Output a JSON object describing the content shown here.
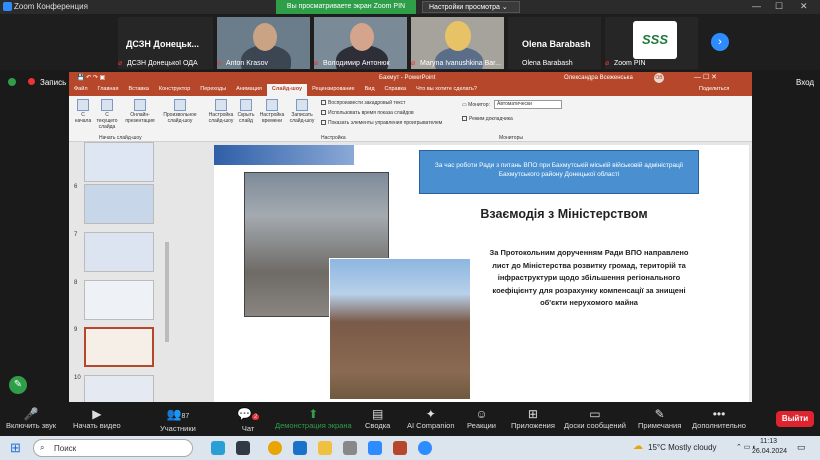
{
  "window": {
    "title": "Zoom Конференция"
  },
  "share": {
    "banner": "Вы просматриваете экран Zoom PIN",
    "settings": "Настройки просмотра"
  },
  "participants": [
    {
      "big_name": "ДСЗН Донецьк...",
      "name": "ДСЗН Донецької ОДА"
    },
    {
      "name": "Anton Krasov"
    },
    {
      "name": "Володимир Антонюк"
    },
    {
      "name": "Maryna Ivanushkina Bar..."
    },
    {
      "big_name": "Olena Barabash",
      "name": "Olena Barabash"
    },
    {
      "name": "Zoom PIN",
      "logo": "SSS"
    }
  ],
  "recording": {
    "label": "Запись",
    "exit_fullscreen": "Вход"
  },
  "ppt": {
    "title_left": "Бахмут - PowerPoint",
    "user": "Олександра Всеженська",
    "user_initials": "ОВ",
    "menu": [
      "Файл",
      "Главная",
      "Вставка",
      "Конструктор",
      "Переходы",
      "Анимация",
      "Слайд-шоу",
      "Рецензирование",
      "Вид",
      "Справка",
      "Что вы хотите сделать?"
    ],
    "active_menu": "Слайд-шоу",
    "share_label": "Поделиться",
    "ribbon": {
      "buttons": [
        "С начала",
        "С текущего слайда",
        "Онлайн-презентация",
        "Произвольное слайд-шоу",
        "Настройка слайд-шоу",
        "Скрыть слайд",
        "Настройка времени",
        "Записать слайд-шоу"
      ],
      "group_start": "Начать слайд-шоу",
      "group_setup": "Настройка",
      "group_monitors": "Мониторы",
      "checks": [
        "Воспроизвести закадровый текст",
        "Использовать время показа слайдов",
        "Показать элементы управления проигрывателем"
      ],
      "monitor_label": "Монитор:",
      "monitor_value": "Автоматически",
      "presenter_view": "Режим докладчика"
    },
    "thumbs": [
      "6",
      "7",
      "8",
      "9",
      "10"
    ]
  },
  "slide": {
    "banner": "За час роботи Ради з питань ВПО при Бахмутській міській військовій адміністрації Бахмутського району Донецької області",
    "title": "Взаємодія з Міністерством",
    "body": "За Протокольним дорученням Ради ВПО направлено лист до Міністерства розвитку громад, територій та інфраструктури щодо збільшення регіонального коефіцієнту для розрахунку компенсації за знищені об'єкти нерухомого майна"
  },
  "toolbar": {
    "audio": "Включить звук",
    "video": "Начать видео",
    "participants": "Участники",
    "participants_count": "87",
    "chat": "Чат",
    "chat_badge": "2",
    "share": "Демонстрация экрана",
    "summary": "Сводка",
    "ai": "AI Companion",
    "reactions": "Реакции",
    "apps": "Приложения",
    "whiteboards": "Доски сообщений",
    "notes": "Примечания",
    "more": "Дополнительно",
    "exit": "Выйти"
  },
  "taskbar": {
    "search": "Поиск",
    "weather": "15°C  Mostly cloudy",
    "time": "11:13",
    "date": "26.04.2024"
  },
  "colors": {
    "ppt_accent": "#b7472a",
    "zoom_blue": "#2d8cff",
    "share_green": "#2e9e48",
    "exit_red": "#e0242f"
  }
}
